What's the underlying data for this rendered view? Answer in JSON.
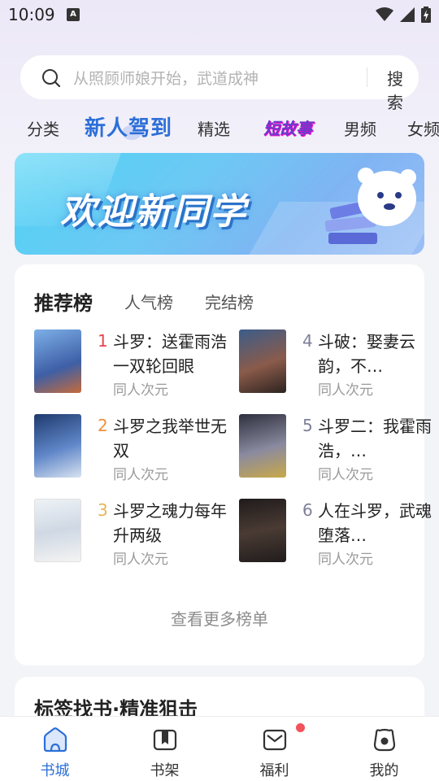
{
  "status": {
    "time": "10:09",
    "badge": "A"
  },
  "search": {
    "placeholder": "从照顾师娘开始，武道成神",
    "button": "搜索"
  },
  "tabs": [
    "分类",
    "新人驾到",
    "精选",
    "短故事",
    "男频",
    "女频"
  ],
  "banner": {
    "title": "欢迎新同学"
  },
  "ranking": {
    "title": "推荐榜",
    "sub_tabs": [
      "人气榜",
      "完结榜"
    ],
    "items": [
      {
        "num": "1",
        "title": "斗罗：送霍雨浩一双轮回眼",
        "genre": "同人次元",
        "num_color": "#e8434f",
        "cover_color": "#5a7fc0"
      },
      {
        "num": "2",
        "title": "斗罗之我举世无双",
        "genre": "同人次元",
        "num_color": "#f0903a",
        "cover_color": "#2b4e8e"
      },
      {
        "num": "3",
        "title": "斗罗之魂力每年升两级",
        "genre": "同人次元",
        "num_color": "#e8b45a",
        "cover_color": "#e9eef4"
      },
      {
        "num": "4",
        "title": "斗破：娶妻云韵，不…",
        "genre": "同人次元",
        "num_color": "#7f7f99",
        "cover_color": "#5a3e3a"
      },
      {
        "num": "5",
        "title": "斗罗二：我霍雨浩，…",
        "genre": "同人次元",
        "num_color": "#7f7f99",
        "cover_color": "#4a4a5e"
      },
      {
        "num": "6",
        "title": "人在斗罗，武魂堕落…",
        "genre": "同人次元",
        "num_color": "#7f7f99",
        "cover_color": "#2e2a2a"
      }
    ],
    "more": "查看更多榜单"
  },
  "tags_section": {
    "title": "标签找书·精准狙击"
  },
  "nav": [
    "书城",
    "书架",
    "福利",
    "我的"
  ],
  "colors": {
    "accent": "#2c6fd8",
    "badge": "#f2525a"
  }
}
